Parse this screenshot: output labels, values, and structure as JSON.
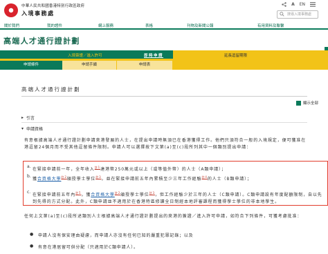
{
  "header": {
    "dept_line1": "中華人民共和國香港特別行政區政府",
    "dept_name": "入境事務處",
    "lang_label": "EN",
    "search_placeholder": "搜尋入境事務處"
  },
  "nav": {
    "items": [
      "關於我們",
      "我的證件",
      "網上服務",
      "表格",
      "刊物及新聞公報",
      "有用資料及聯繫"
    ]
  },
  "page": {
    "title": "高端人才通行證計劃"
  },
  "subtabs": {
    "entry": "入境簽證／進入許可",
    "current": "即時申請",
    "extension": "延長逗留期限"
  },
  "tabs": [
    "申請條件",
    "申請手續",
    "申請表"
  ],
  "content": {
    "title": "高端人才通行證計劃",
    "expand_all": "顯示全部",
    "sections": [
      "引言",
      "申請資格"
    ],
    "intro_para": "有意根據高端人才通行證計劃申請來港發展的人士，在提出申請時無須已在香港獲得工作。他們只須符合一般的入境規定，便可獲准在港逗留24個月而不受其他逗留條件限制。申請人可以選擇按下文第(a)至(c)段所列其中一個類別提出申請：",
    "items": [
      {
        "label": "a.",
        "text": "在緊接申請前一年，全年收入",
        "sup": "註1",
        "text2": "達港幣250萬元或以上（或等值外幣）的人士（A類申請）；"
      },
      {
        "label": "b.",
        "pre": "獲",
        "link": "合資格大學",
        "sup1": "註2",
        "mid": "頒授學士學位",
        "sup2": "註3",
        "post": "，並在緊接申請前五年內累積至少三年工作經驗",
        "sup3": "註4",
        "post2": "的人士（B類申請）；"
      },
      {
        "label": "c.",
        "pre": "在緊接申請前五年內",
        "sup1": "註5",
        "mid": "，獲",
        "link": "合資格大學",
        "sup2": "註2",
        "post": "頒授學士學位",
        "sup3": "註3",
        "post2": "，但工作經驗少於三年的人士（C類申請）。C類申請設有年度配額限制，自以先到先得的方式分配。此外，C類申請並不適用於在香港特區修讀全日制經本地評審課程而獲得學士學位的非本地學生。"
      }
    ],
    "para2": "任何上文第(a)至(c)段所述類別人士根據高端人才通行證計劃提出的來港的簽證／進入許可申請，如符合下列條件，可獲考慮批准：",
    "bullets": [
      "申請人沒有保安理由疑慮，而申請人亦沒有任何已知的嚴重犯罪記錄；以及",
      "有意在港居留可供分配（只適用於C類申請人）。"
    ]
  },
  "colors": {
    "brand_green": "#0a7a5a",
    "tab_yellow": "#f2c318",
    "highlight_red": "#e23c2b"
  }
}
